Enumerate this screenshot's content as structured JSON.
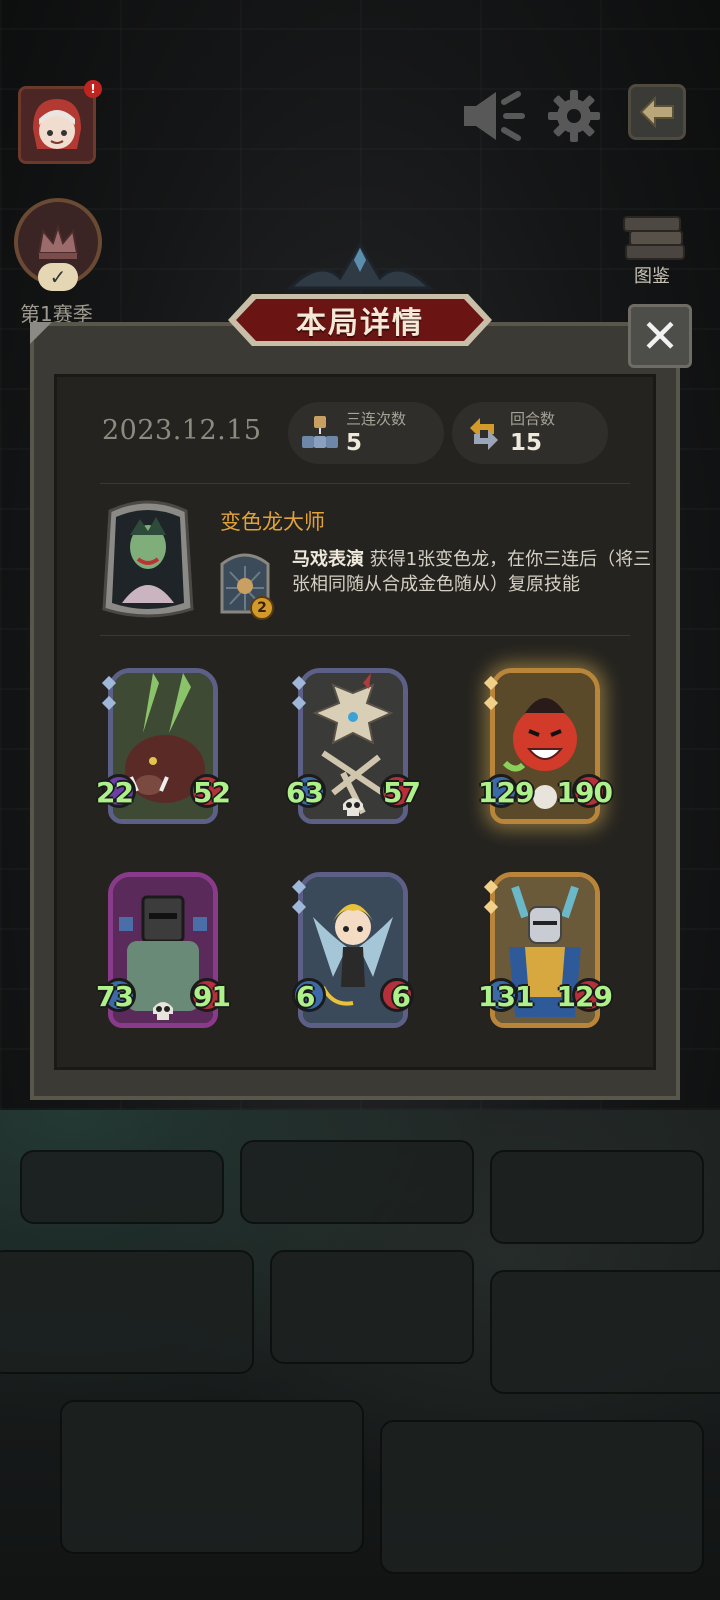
{
  "header": {
    "notification_badge": "!",
    "season_label": "第1赛季",
    "codex_label": "图鉴"
  },
  "panel": {
    "title": "本局详情",
    "close_glyph": "✕",
    "date": "2023.12.15",
    "stats": [
      {
        "label": "三连次数",
        "value": "5"
      },
      {
        "label": "回合数",
        "value": "15"
      }
    ],
    "hero": {
      "name": "变色龙大师",
      "power_level": "2",
      "skill_name": "马戏表演",
      "skill_desc": " 获得1张变色龙，在你三连后（将三张相同随从合成金色随从）复原技能"
    },
    "minions": [
      {
        "attack": "22",
        "health": "52",
        "golden": false,
        "art": "boar"
      },
      {
        "attack": "63",
        "health": "57",
        "golden": false,
        "art": "skeleton-dragon"
      },
      {
        "attack": "129",
        "health": "190",
        "golden": true,
        "art": "red-imp"
      },
      {
        "attack": "73",
        "health": "91",
        "golden": false,
        "art": "iron-golem"
      },
      {
        "attack": "6",
        "health": "6",
        "golden": false,
        "art": "fairy"
      },
      {
        "attack": "131",
        "health": "129",
        "golden": true,
        "art": "knight"
      }
    ]
  },
  "colors": {
    "accent_gold": "#e2a23a",
    "stat_green": "#aef08a",
    "title_red": "#6a1414"
  }
}
